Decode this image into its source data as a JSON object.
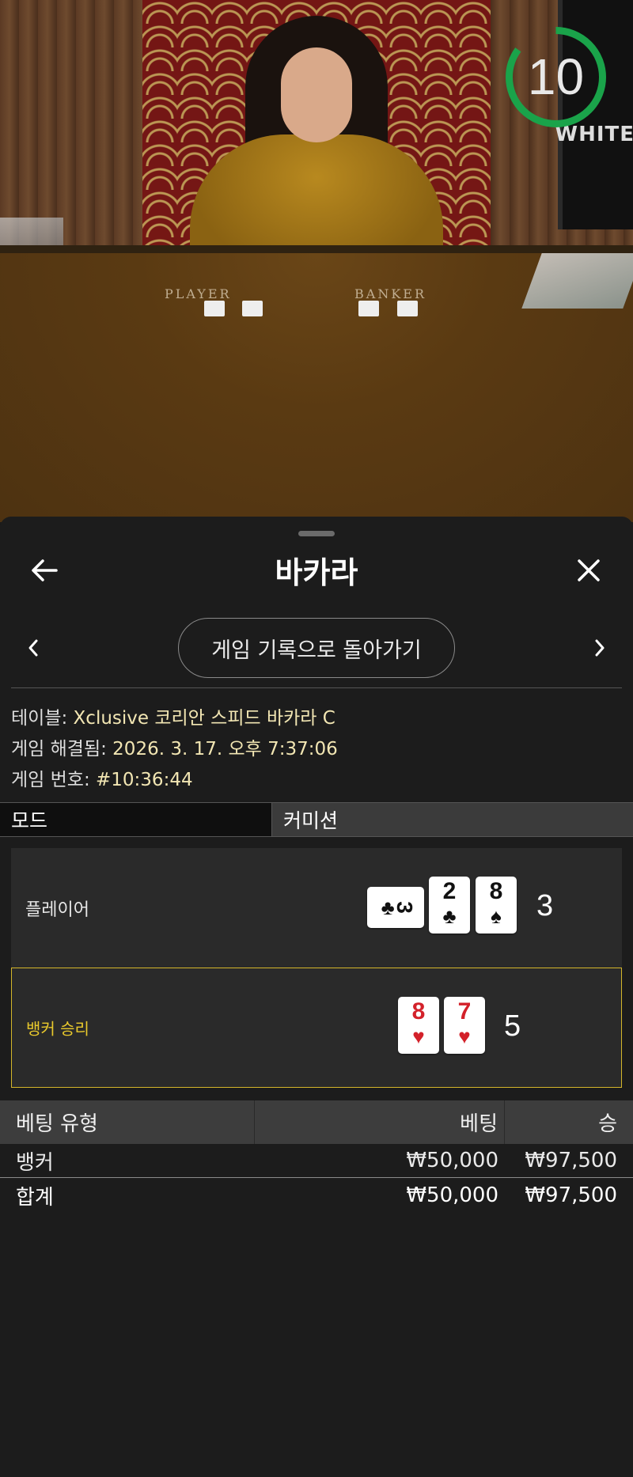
{
  "video": {
    "timer": "10",
    "monitor_text": "WHITE",
    "felt_player": "PLAYER",
    "felt_banker": "BANKER",
    "timer_progress": 0.85,
    "timer_color": "#1aa34a"
  },
  "sheet": {
    "title": "바카라",
    "back_icon": "arrow-left-icon",
    "close_icon": "close-icon",
    "back_to_history": "게임 기록으로 돌아가기",
    "info": {
      "table_label": "테이블: ",
      "table_value": "Xclusive 코리안 스피드 바카라 C",
      "resolved_label": "게임 해결됨: ",
      "resolved_value": "2026. 3. 17. 오후 7:37:06",
      "number_label": "게임 번호: ",
      "number_value": "#10:36:44"
    },
    "mode": {
      "key": "모드",
      "value": "커미션"
    },
    "player": {
      "label": "플레이어",
      "score": "3",
      "cards": [
        {
          "rank": "3",
          "suit": "♣",
          "color": "black",
          "sideways": true
        },
        {
          "rank": "2",
          "suit": "♣",
          "color": "black"
        },
        {
          "rank": "8",
          "suit": "♠",
          "color": "black"
        }
      ]
    },
    "banker": {
      "label": "뱅커 승리",
      "score": "5",
      "cards": [
        {
          "rank": "8",
          "suit": "♥",
          "color": "red"
        },
        {
          "rank": "7",
          "suit": "♥",
          "color": "red"
        }
      ]
    },
    "bets": {
      "headers": {
        "type": "베팅 유형",
        "bet": "베팅",
        "win": "승"
      },
      "rows": [
        {
          "type": "뱅커",
          "bet": "₩50,000",
          "win": "₩97,500"
        }
      ],
      "total": {
        "label": "합계",
        "bet": "₩50,000",
        "win": "₩97,500"
      }
    },
    "accent_win": "#d4b52a"
  }
}
